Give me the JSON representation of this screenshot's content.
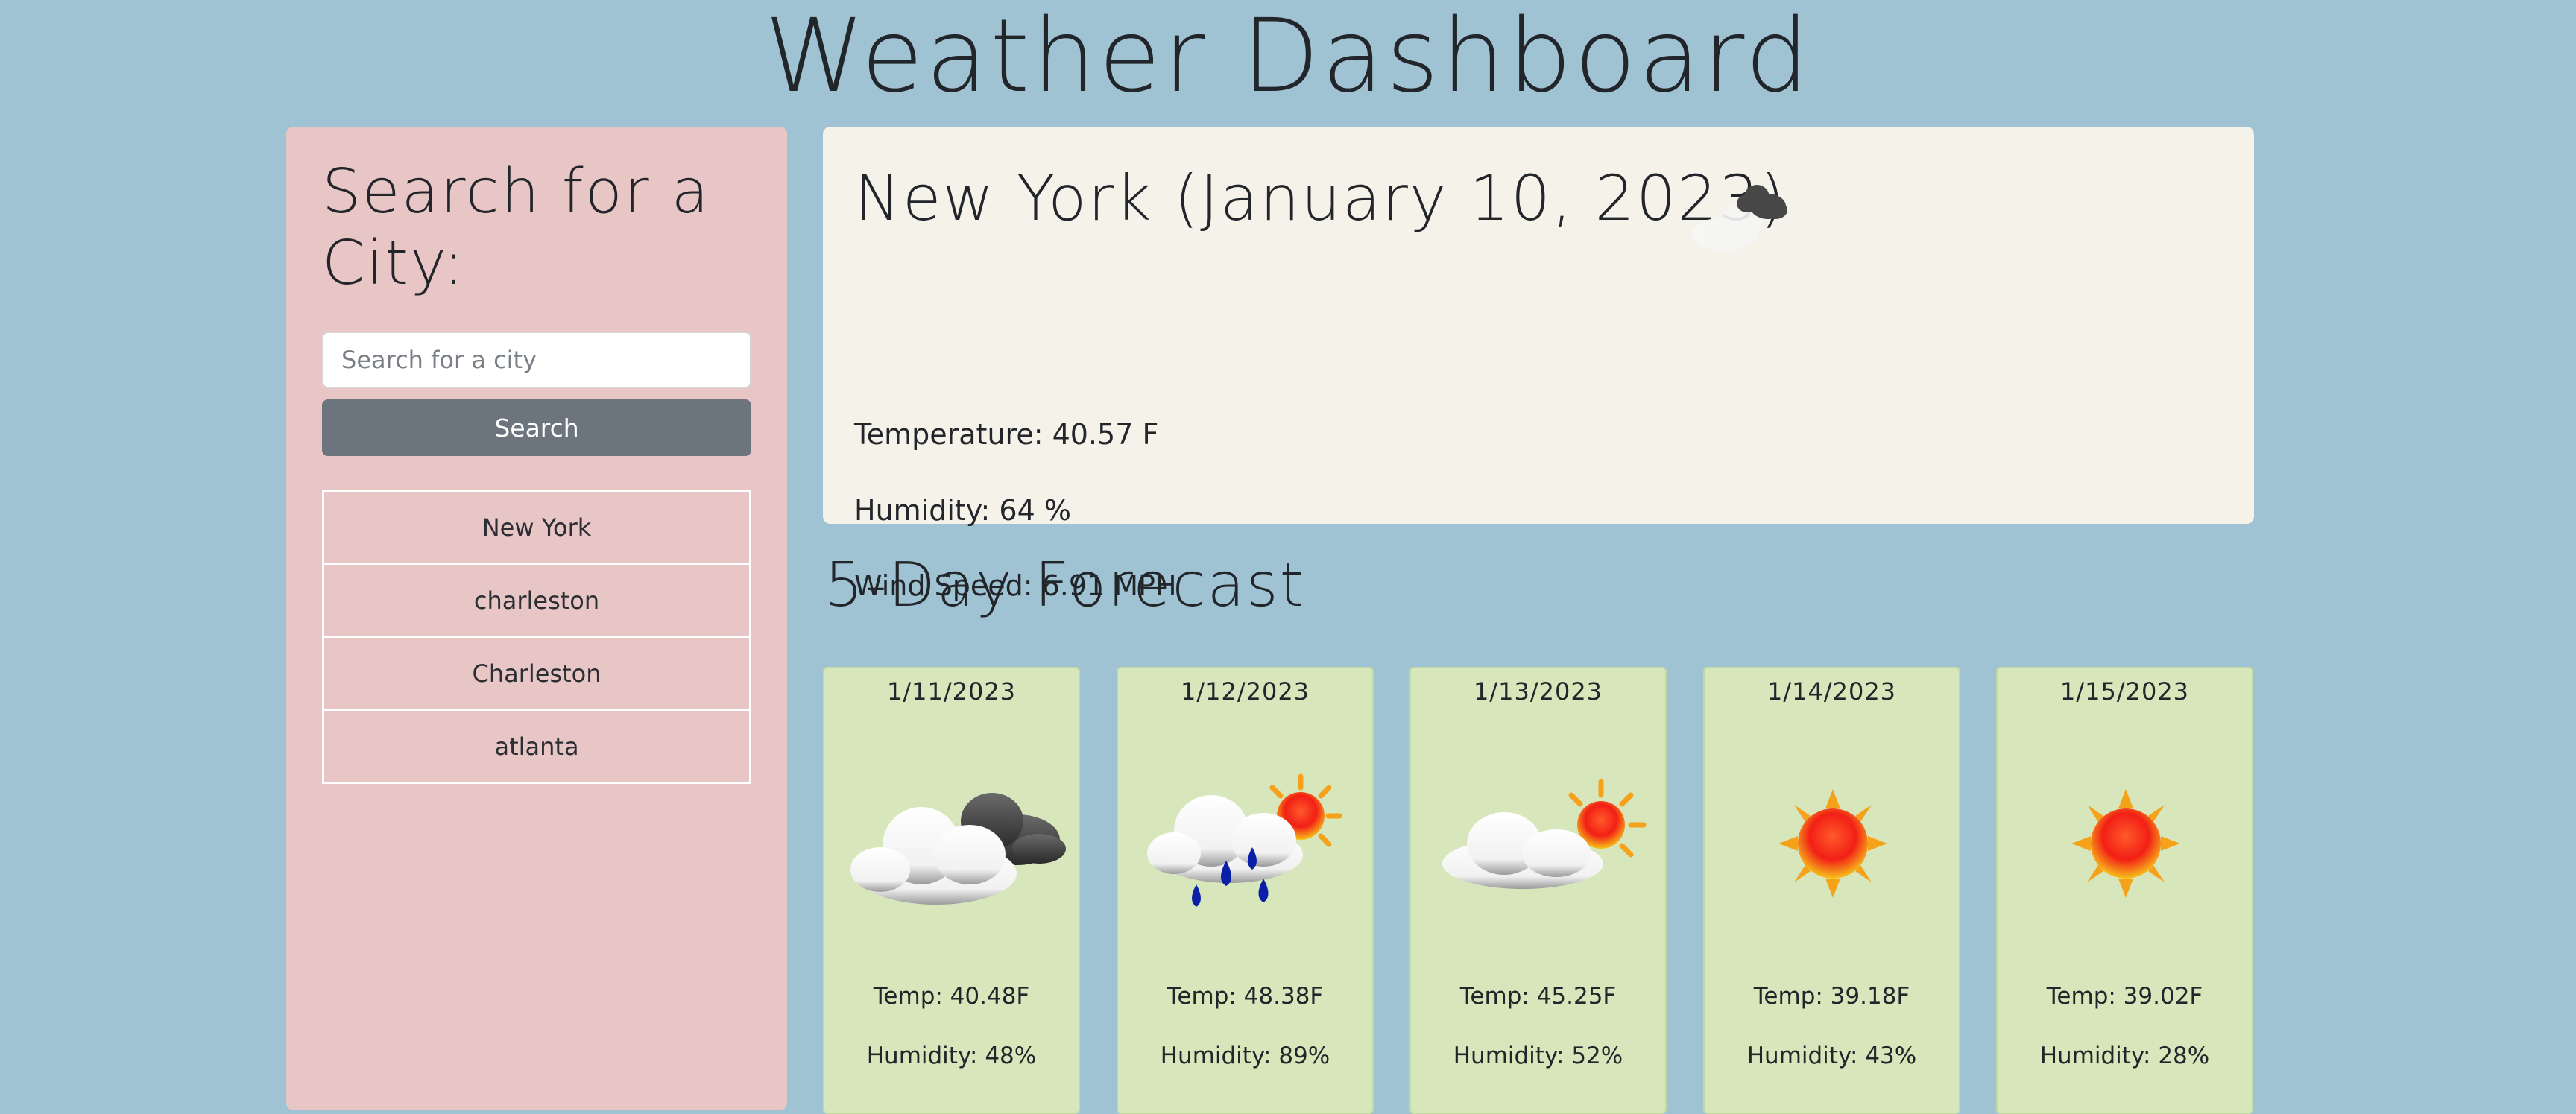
{
  "page": {
    "title": "Weather Dashboard"
  },
  "sidebar": {
    "title": "Search for a City:",
    "search": {
      "placeholder": "Search for a city",
      "value": ""
    },
    "search_button_label": "Search",
    "history": [
      "New York",
      "charleston",
      "Charleston",
      "atlanta"
    ]
  },
  "current": {
    "title": "New York (January 10, 2023)",
    "icon": "night-cloudy-icon",
    "temperature": "Temperature: 40.57 F",
    "humidity": "Humidity: 64 %",
    "wind": "Wind Speed: 6.91 MPH"
  },
  "forecast": {
    "title": "5-Day Forecast",
    "days": [
      {
        "date": "1/11/2023",
        "icon": "cloudy-dark-cloud-icon",
        "temp": "Temp: 40.48F",
        "humidity": "Humidity: 48%"
      },
      {
        "date": "1/12/2023",
        "icon": "rain-sun-icon",
        "temp": "Temp: 48.38F",
        "humidity": "Humidity: 89%"
      },
      {
        "date": "1/13/2023",
        "icon": "partly-sunny-icon",
        "temp": "Temp: 45.25F",
        "humidity": "Humidity: 52%"
      },
      {
        "date": "1/14/2023",
        "icon": "sun-icon",
        "temp": "Temp: 39.18F",
        "humidity": "Humidity: 43%"
      },
      {
        "date": "1/15/2023",
        "icon": "sun-icon",
        "temp": "Temp: 39.02F",
        "humidity": "Humidity: 28%"
      }
    ]
  },
  "colors": {
    "background": "#9fc3d3",
    "sidebar": "#e8c6c6",
    "current_card": "#f5f2ea",
    "forecast_card": "#d7e7bb",
    "button": "#6c757d"
  }
}
